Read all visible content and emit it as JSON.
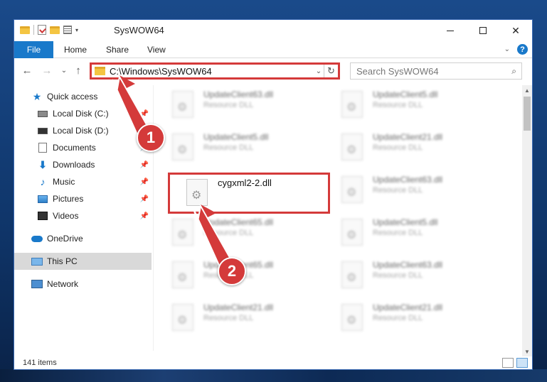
{
  "window": {
    "title": "SysWOW64",
    "quick_access_dropdown": "▾",
    "controls": {
      "minimize": "–",
      "maximize": "□",
      "close": "✕"
    }
  },
  "ribbon": {
    "tabs": [
      {
        "label": "File"
      },
      {
        "label": "Home"
      },
      {
        "label": "Share"
      },
      {
        "label": "View"
      }
    ],
    "collapse_glyph": "⌄",
    "help_glyph": "?"
  },
  "nav": {
    "back": "←",
    "forward": "→",
    "recent": "⌄",
    "up": "↑",
    "address_path": "C:\\Windows\\SysWOW64",
    "address_dropdown": "⌄",
    "refresh": "↻",
    "search_placeholder": "Search SysWOW64",
    "search_glyph": "⌕"
  },
  "sidebar": {
    "items": [
      {
        "label": "Quick access",
        "icon": "star-icon",
        "pinned": false
      },
      {
        "label": "Local Disk (C:)",
        "icon": "disk-icon",
        "pinned": true
      },
      {
        "label": "Local Disk (D:)",
        "icon": "disk-icon",
        "pinned": false
      },
      {
        "label": "Documents",
        "icon": "document-icon",
        "pinned": true
      },
      {
        "label": "Downloads",
        "icon": "download-icon",
        "pinned": true
      },
      {
        "label": "Music",
        "icon": "music-icon",
        "pinned": true
      },
      {
        "label": "Pictures",
        "icon": "picture-icon",
        "pinned": true
      },
      {
        "label": "Videos",
        "icon": "video-icon",
        "pinned": true
      },
      {
        "label": "OneDrive",
        "icon": "cloud-icon",
        "pinned": false
      },
      {
        "label": "This PC",
        "icon": "computer-icon",
        "pinned": false,
        "selected": true
      },
      {
        "label": "Network",
        "icon": "network-icon",
        "pinned": false
      }
    ],
    "pin_glyph": "📌"
  },
  "files": {
    "items": [
      {
        "name": "UpdateClient63.dll",
        "desc": "Resource DLL"
      },
      {
        "name": "UpdateClient5.dll",
        "desc": "Resource DLL"
      },
      {
        "name": "UpdateClient5.dll",
        "desc": "Resource DLL"
      },
      {
        "name": "UpdateClient21.dll",
        "desc": "Resource DLL"
      },
      {
        "name": "cygxml2-2.dll",
        "desc": ""
      },
      {
        "name": "UpdateClient63.dll",
        "desc": "Resource DLL"
      },
      {
        "name": "UpdateClient65.dll",
        "desc": "Resource DLL"
      },
      {
        "name": "UpdateClient5.dll",
        "desc": "Resource DLL"
      },
      {
        "name": "UpdateClient65.dll",
        "desc": "Resource DLL"
      },
      {
        "name": "UpdateClient63.dll",
        "desc": "Resource DLL"
      },
      {
        "name": "UpdateClient21.dll",
        "desc": "Resource DLL"
      },
      {
        "name": "UpdateClient21.dll",
        "desc": "Resource DLL"
      }
    ]
  },
  "status": {
    "item_count": "141 items"
  },
  "annotations": {
    "step1": "1",
    "step2": "2"
  },
  "colors": {
    "accent": "#1979ca",
    "highlight": "#d43a3a",
    "selected": "#d9d9d9"
  }
}
